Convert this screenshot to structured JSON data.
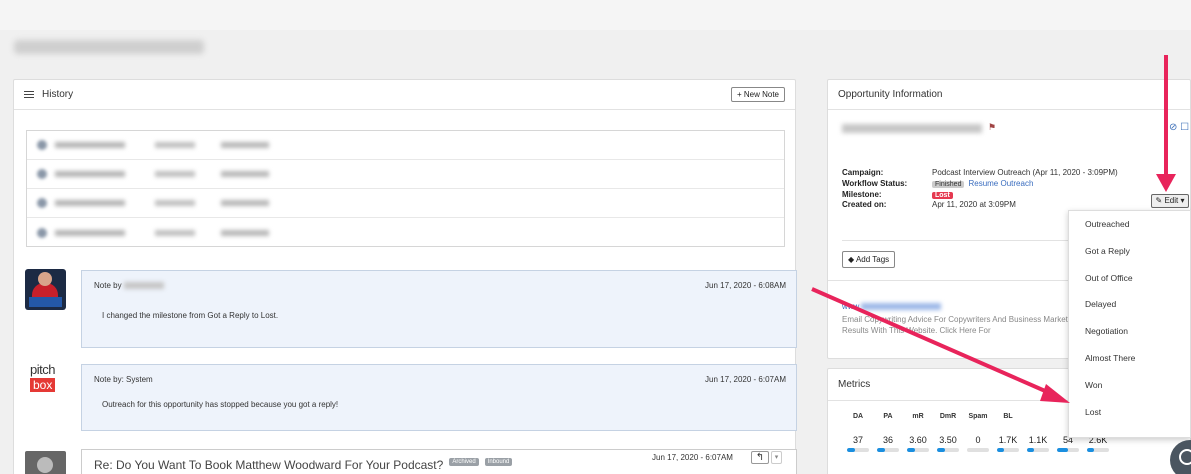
{
  "history": {
    "title": "History",
    "new_note_label": "+ New Note",
    "notes": [
      {
        "by_label": "Note by",
        "date": "Jun 17, 2020 - 6:08AM",
        "body": "I changed the milestone from Got a Reply to Lost."
      },
      {
        "by_label": "Note by: System",
        "date": "Jun 17, 2020 - 6:07AM",
        "body": "Outreach for this opportunity has stopped because you got a reply!"
      }
    ],
    "pitchbox_logo": {
      "pitch": "pitch",
      "box": "box"
    },
    "email": {
      "subject": "Re: Do You Want To Book Matthew Woodward For Your Podcast?",
      "tags": [
        "Archived",
        "Inbound"
      ],
      "date": "Jun 17, 2020 - 6:07AM",
      "reply_icon": "↰",
      "caret_icon": "▾"
    }
  },
  "opportunity": {
    "title": "Opportunity Information",
    "flag_icon": "⚑",
    "action_icons": "⊘ ☐",
    "campaign_label": "Campaign:",
    "campaign_value": "Podcast Interview Outreach (Apr 11, 2020 - 3:09PM)",
    "workflow_label": "Workflow Status:",
    "workflow_badge": "Finished",
    "workflow_link": "Resume Outreach",
    "milestone_label": "Milestone:",
    "milestone_value": "Lost",
    "created_label": "Created on:",
    "created_value": "Apr 11, 2020 at 3:09PM",
    "add_tags_label": "Add Tags",
    "tag_icon": "◆",
    "site_prefix": "www.",
    "description": "Email Copywriting Advice For Copywriters And Business Marketing Results With This Website. Click Here For",
    "edit_label": "✎ Edit ▾"
  },
  "milestone_dropdown": {
    "options": [
      "Outreached",
      "Got a Reply",
      "Out of Office",
      "Delayed",
      "Negotiation",
      "Almost There",
      "Won",
      "Lost"
    ]
  },
  "metrics": {
    "title": "Metrics",
    "columns": [
      {
        "label": "DA",
        "value": "37",
        "fill": 0.37
      },
      {
        "label": "PA",
        "value": "36",
        "fill": 0.36
      },
      {
        "label": "mR",
        "value": "3.60",
        "fill": 0.36
      },
      {
        "label": "DmR",
        "value": "3.50",
        "fill": 0.35
      },
      {
        "label": "Spam",
        "value": "0",
        "fill": 0
      },
      {
        "label": "BL",
        "value": "1.7K",
        "fill": 0.3
      },
      {
        "label": "",
        "value": "1.1K",
        "fill": 0.3
      },
      {
        "label": "",
        "value": "54",
        "fill": 0.5
      },
      {
        "label": "",
        "value": "2.6K",
        "fill": 0.3
      }
    ]
  },
  "colors": {
    "accent": "#3a6dbf",
    "lost": "#e53950",
    "arrow": "#e8245b",
    "metric_bar": "#1a8fe0"
  }
}
